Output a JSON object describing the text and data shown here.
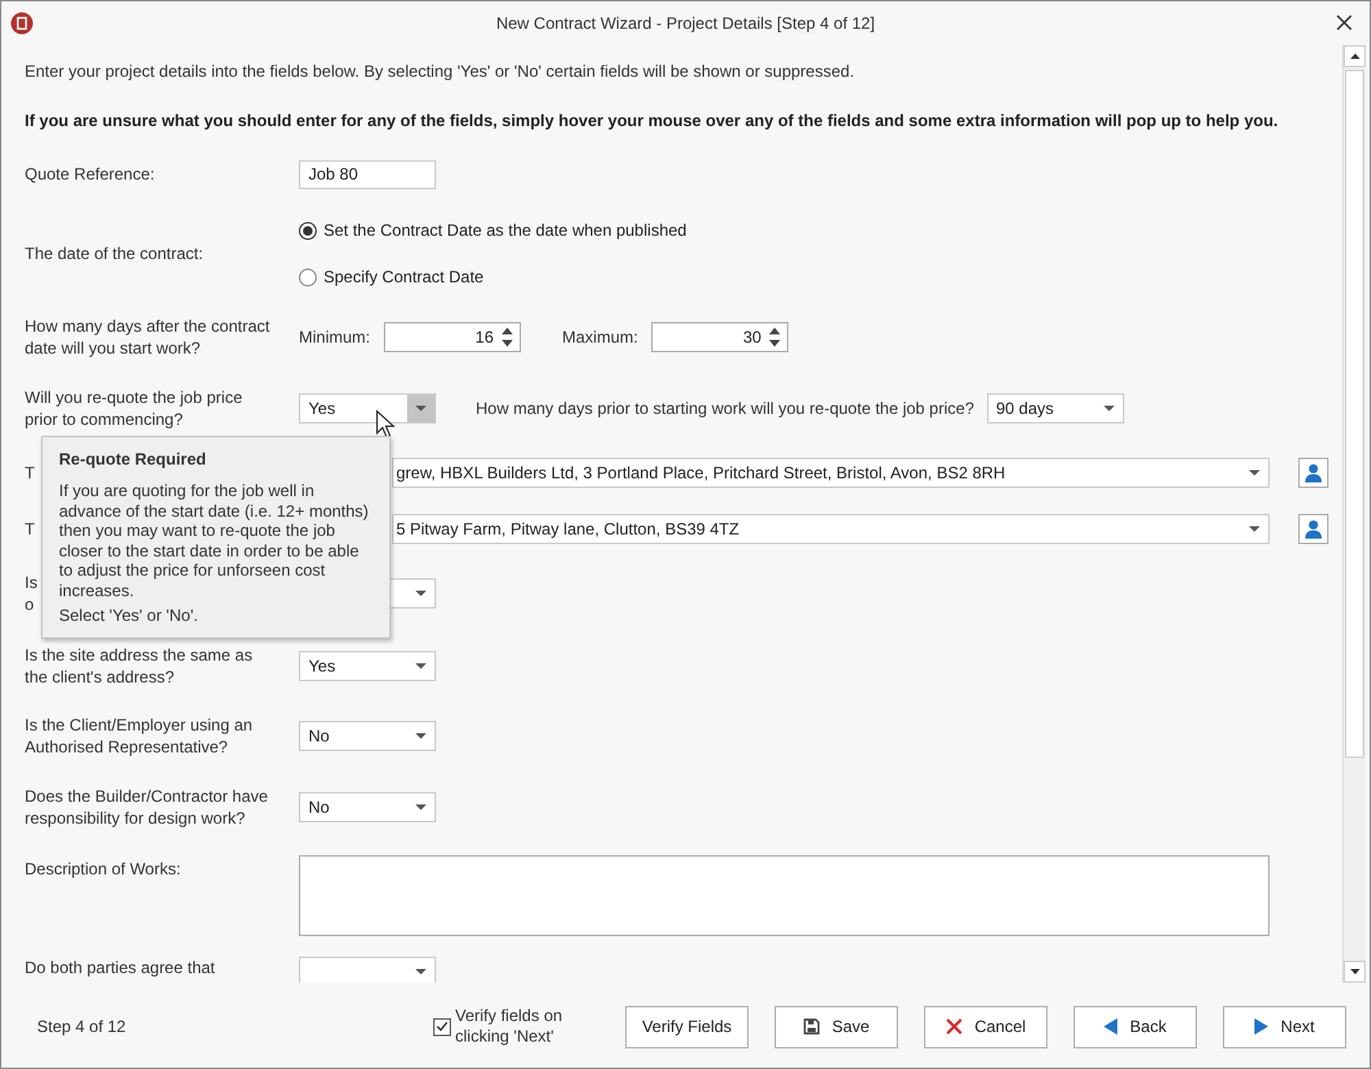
{
  "window": {
    "title": "New Contract Wizard - Project Details [Step 4 of 12]"
  },
  "intro": "Enter your project details into the fields below.  By selecting 'Yes' or 'No' certain fields will be shown or suppressed.",
  "hint": "If you are unsure what you should enter for any of the fields, simply hover your mouse over any of the fields and some extra information will pop up to help you.",
  "fields": [
    {
      "kind": "text",
      "label": "Quote Reference:",
      "value": "Job 80"
    },
    {
      "kind": "radio",
      "label": "The date of the contract:",
      "options": [
        {
          "label": "Set the Contract Date as the date when published",
          "selected": true
        },
        {
          "label": "Specify Contract Date",
          "selected": false
        }
      ]
    },
    {
      "kind": "range",
      "label": "How many days after the contract date will you start work?",
      "min_label": "Minimum:",
      "min_value": "16",
      "max_label": "Maximum:",
      "max_value": "30"
    },
    {
      "kind": "requote",
      "label": "Will you re-quote the job price prior to commencing?",
      "value": "Yes",
      "hovered": true,
      "follow_label": "How many days prior to starting work will you re-quote the job price?",
      "follow_value": "90 days"
    },
    {
      "kind": "contact",
      "label": "T",
      "value": "grew, HBXL Builders Ltd, 3 Portland Place, Pritchard Street, Bristol, Avon, BS2 8RH"
    },
    {
      "kind": "contact",
      "label": "T",
      "value": "5 Pitway Farm, Pitway lane, Clutton, BS39 4TZ"
    },
    {
      "kind": "select",
      "label": "Is\no"
    },
    {
      "kind": "select",
      "label": "Is the site address the same as the client's address?",
      "value": "Yes"
    },
    {
      "kind": "select",
      "label": "Is the Client/Employer using an Authorised Representative?",
      "value": "No"
    },
    {
      "kind": "select",
      "label": "Does the Builder/Contractor have responsibility for design work?",
      "value": "No"
    },
    {
      "kind": "textarea",
      "label": "Description of Works:"
    },
    {
      "kind": "select",
      "label": "Do both parties agree that"
    }
  ],
  "tooltip": {
    "title": "Re-quote Required",
    "body": "If you are quoting for the job well in advance of the start date (i.e. 12+ months) then you may want to re-quote the job closer to the start date in order to be able to adjust the price for unforseen cost increases.",
    "note": "Select 'Yes' or 'No'."
  },
  "footer": {
    "step": "Step 4 of 12",
    "verify": {
      "label": "Verify fields on clicking 'Next'",
      "checked": true
    },
    "buttons": [
      {
        "kind": "plain",
        "label": "Verify Fields"
      },
      {
        "kind": "save",
        "label": "Save"
      },
      {
        "kind": "cancel",
        "label": "Cancel"
      },
      {
        "kind": "back",
        "label": "Back"
      },
      {
        "kind": "next",
        "label": "Next"
      }
    ]
  }
}
